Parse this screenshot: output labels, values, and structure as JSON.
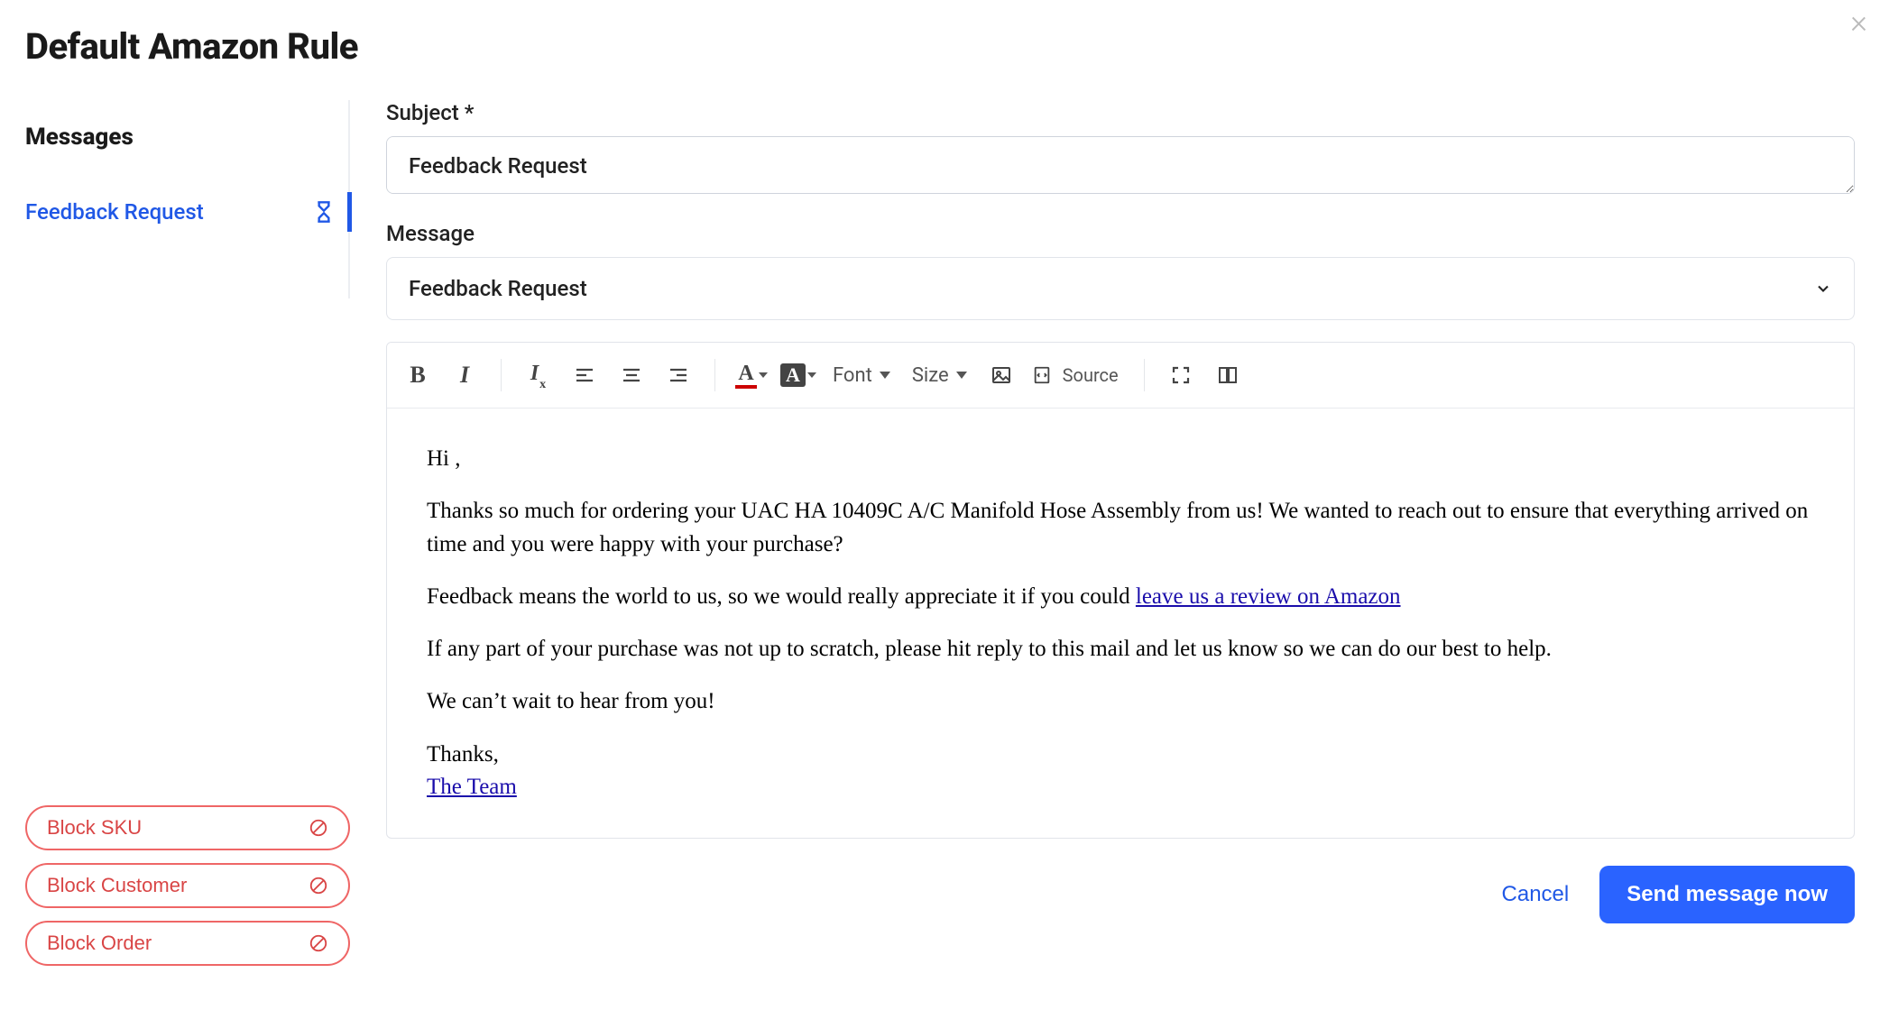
{
  "title": "Default Amazon Rule",
  "close_symbol": "×",
  "sidebar": {
    "heading": "Messages",
    "items": [
      {
        "label": "Feedback Request",
        "icon": "hourglass-icon"
      }
    ]
  },
  "block_buttons": [
    {
      "label": "Block SKU",
      "name": "block-sku-button"
    },
    {
      "label": "Block Customer",
      "name": "block-customer-button"
    },
    {
      "label": "Block Order",
      "name": "block-order-button"
    }
  ],
  "form": {
    "subject_label": "Subject *",
    "subject_value": "Feedback Request",
    "message_label": "Message",
    "template_select_value": "Feedback Request"
  },
  "toolbar": {
    "font_label": "Font",
    "size_label": "Size",
    "source_label": "Source"
  },
  "editor": {
    "p1": "Hi ,",
    "p2": "Thanks so much for ordering your UAC HA 10409C A/C Manifold Hose Assembly from us! We wanted to reach out to ensure that everything arrived on time and you were happy with your purchase?",
    "p3_prefix": "Feedback means the world to us, so we would really appreciate it if you could ",
    "p3_link": "leave us a review on Amazon",
    "p4": "If any part of your purchase was not up to scratch, please hit reply to this mail and let us know so we can do our best to help.",
    "p5": "We can’t wait to hear from you!",
    "signoff": "Thanks,",
    "team_link": "The Team"
  },
  "footer": {
    "cancel": "Cancel",
    "send": "Send message now"
  }
}
